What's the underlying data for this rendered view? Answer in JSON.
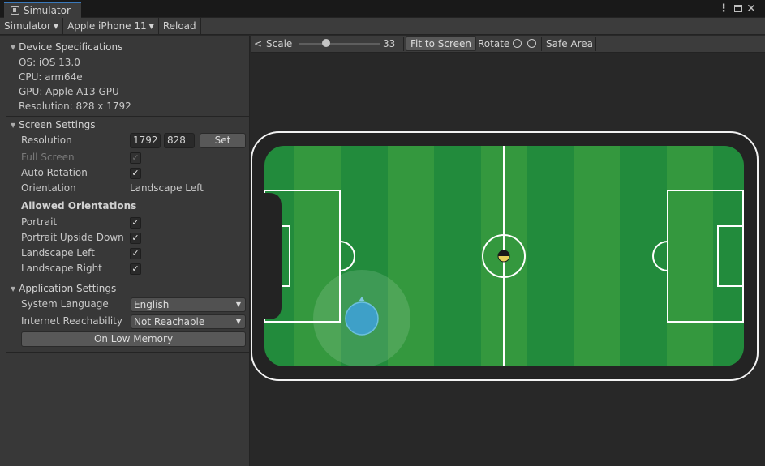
{
  "window": {
    "tab_title": "Simulator",
    "tab_icon": "simulator-window-icon",
    "controls": {
      "kebab": "⋮",
      "close": "✕"
    }
  },
  "toolbar": {
    "simulator_label": "Simulator",
    "device_label": "Apple iPhone 11",
    "reload_label": "Reload"
  },
  "device_specs": {
    "header": "Device Specifications",
    "os": "OS: iOS 13.0",
    "cpu": "CPU: arm64e",
    "gpu": "GPU: Apple A13 GPU",
    "resolution": "Resolution: 828 x 1792"
  },
  "screen_settings": {
    "header": "Screen Settings",
    "resolution_label": "Resolution",
    "resolution_width": "1792",
    "resolution_height": "828",
    "set_label": "Set",
    "full_screen_label": "Full Screen",
    "full_screen_checked": true,
    "auto_rotation_label": "Auto Rotation",
    "auto_rotation_checked": true,
    "orientation_label": "Orientation",
    "orientation_value": "Landscape Left",
    "allowed_header": "Allowed Orientations",
    "allowed": [
      {
        "label": "Portrait",
        "checked": true
      },
      {
        "label": "Portrait Upside Down",
        "checked": true
      },
      {
        "label": "Landscape Left",
        "checked": true
      },
      {
        "label": "Landscape Right",
        "checked": true
      }
    ]
  },
  "app_settings": {
    "header": "Application Settings",
    "language_label": "System Language",
    "language_value": "English",
    "reachability_label": "Internet Reachability",
    "reachability_value": "Not Reachable",
    "low_memory_label": "On Low Memory"
  },
  "view_toolbar": {
    "back_glyph": "<",
    "scale_label": "Scale",
    "scale_value": "33",
    "scale_fraction": 0.33,
    "fit_label": "Fit to Screen",
    "rotate_label": "Rotate",
    "safe_area_label": "Safe Area"
  },
  "colors": {
    "accent": "#3a79bb",
    "pitch_light": "#34983e",
    "pitch_dark": "#228b3c",
    "joystick": "#3ea0c8"
  }
}
